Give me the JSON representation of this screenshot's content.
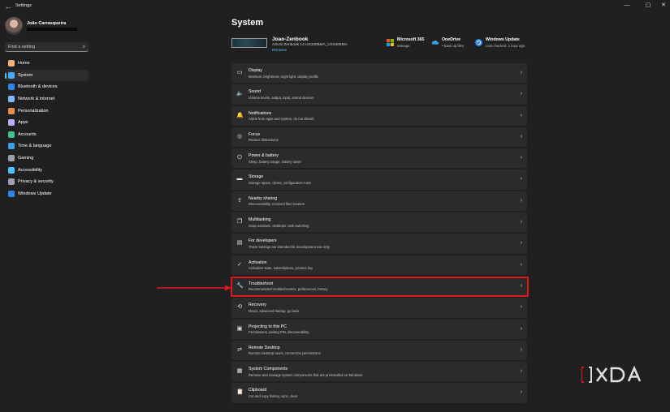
{
  "window": {
    "app_title": "Settings",
    "controls": {
      "minimize": "—",
      "maximize": "▢",
      "close": "✕"
    }
  },
  "profile": {
    "name": "João Carrasqueira"
  },
  "search": {
    "placeholder": "Find a setting"
  },
  "sidebar": {
    "items": [
      {
        "label": "Home",
        "icon": "home-icon",
        "color": "#f3b27a"
      },
      {
        "label": "System",
        "icon": "monitor-icon",
        "color": "#4aa8ff",
        "selected": true
      },
      {
        "label": "Bluetooth & devices",
        "icon": "bluetooth-icon",
        "color": "#2f86e8"
      },
      {
        "label": "Network & internet",
        "icon": "wifi-icon",
        "color": "#7fb8ff"
      },
      {
        "label": "Personalization",
        "icon": "brush-icon",
        "color": "#e58f4a"
      },
      {
        "label": "Apps",
        "icon": "apps-icon",
        "color": "#b6b0ff"
      },
      {
        "label": "Accounts",
        "icon": "person-icon",
        "color": "#3fc58a"
      },
      {
        "label": "Time & language",
        "icon": "globe-clock-icon",
        "color": "#3aa0e8"
      },
      {
        "label": "Gaming",
        "icon": "gamepad-icon",
        "color": "#9aa0a8"
      },
      {
        "label": "Accessibility",
        "icon": "accessibility-icon",
        "color": "#4cc2ff"
      },
      {
        "label": "Privacy & security",
        "icon": "shield-icon",
        "color": "#9aa4b0"
      },
      {
        "label": "Windows Update",
        "icon": "windows-update-icon",
        "color": "#2f86e8"
      }
    ]
  },
  "main": {
    "title": "System",
    "device": {
      "name": "Joao-Zenbook",
      "model": "ASUS Zenbook 14 UX3405MA_UX3405MA",
      "rename": "Rename"
    },
    "status": [
      {
        "title": "Microsoft 365",
        "sub": "Manage",
        "icon": "microsoft-icon"
      },
      {
        "title": "OneDrive",
        "sub": "• Back up files",
        "icon": "onedrive-icon"
      },
      {
        "title": "Windows Update",
        "sub": "Last checked: 1 hour ago",
        "icon": "windows-update-icon"
      }
    ],
    "cards": [
      {
        "title": "Display",
        "sub": "Monitors, brightness, night light, display profile",
        "icon": "display-icon",
        "glyph": "▭"
      },
      {
        "title": "Sound",
        "sub": "Volume levels, output, input, sound devices",
        "icon": "speaker-icon",
        "glyph": "🔈"
      },
      {
        "title": "Notifications",
        "sub": "Alerts from apps and system, do not disturb",
        "icon": "bell-icon",
        "glyph": "🔔"
      },
      {
        "title": "Focus",
        "sub": "Reduce distractions",
        "icon": "focus-icon",
        "glyph": "◎"
      },
      {
        "title": "Power & battery",
        "sub": "Sleep, battery usage, battery saver",
        "icon": "power-icon",
        "glyph": "⏻"
      },
      {
        "title": "Storage",
        "sub": "Storage space, drives, configuration rules",
        "icon": "storage-icon",
        "glyph": "▬"
      },
      {
        "title": "Nearby sharing",
        "sub": "Discoverability, received files location",
        "icon": "share-icon",
        "glyph": "⇪"
      },
      {
        "title": "Multitasking",
        "sub": "Snap windows, desktops, task switching",
        "icon": "multitask-icon",
        "glyph": "❐"
      },
      {
        "title": "For developers",
        "sub": "These settings are intended for development use only",
        "icon": "developer-icon",
        "glyph": "▤"
      },
      {
        "title": "Activation",
        "sub": "Activation state, subscriptions, product key",
        "icon": "activation-icon",
        "glyph": "✓"
      },
      {
        "title": "Troubleshoot",
        "sub": "Recommended troubleshooters, preferences, history",
        "icon": "wrench-icon",
        "glyph": "🔧"
      },
      {
        "title": "Recovery",
        "sub": "Reset, advanced startup, go back",
        "icon": "recovery-icon",
        "glyph": "⟲"
      },
      {
        "title": "Projecting to this PC",
        "sub": "Permissions, pairing PIN, discoverability",
        "icon": "projector-icon",
        "glyph": "▣"
      },
      {
        "title": "Remote Desktop",
        "sub": "Remote Desktop users, connection permissions",
        "icon": "remote-desktop-icon",
        "glyph": "⇄"
      },
      {
        "title": "System Components",
        "sub": "Remove and manage system components that are preinstalled on Windows",
        "icon": "components-icon",
        "glyph": "▦"
      },
      {
        "title": "Clipboard",
        "sub": "Cut and copy history, sync, clear",
        "icon": "clipboard-icon",
        "glyph": "📋"
      }
    ]
  },
  "watermark": {
    "text": "XDA"
  },
  "colors": {
    "accent": "#4cc2ff",
    "highlight": "#e0161e",
    "card_bg": "#2b2b2b",
    "bg": "#202020"
  }
}
